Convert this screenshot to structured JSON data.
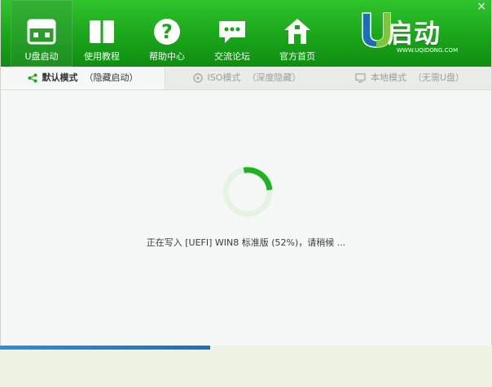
{
  "nav": {
    "items": [
      {
        "label": "U盘启动",
        "icon": "usb-drive-icon"
      },
      {
        "label": "使用教程",
        "icon": "book-icon"
      },
      {
        "label": "帮助中心",
        "icon": "help-question-icon"
      },
      {
        "label": "交流论坛",
        "icon": "chat-bubble-icon"
      },
      {
        "label": "官方首页",
        "icon": "home-icon"
      }
    ]
  },
  "logo": {
    "text": "启动",
    "url": "WWW.UQIDONG.COM"
  },
  "window": {
    "close_label": "×"
  },
  "tabs": [
    {
      "label": "默认模式",
      "sub": "（隐藏启动）",
      "icon": "share-node-icon"
    },
    {
      "label": "ISO模式",
      "sub": "（深度隐藏）",
      "icon": "disc-icon"
    },
    {
      "label": "本地模式",
      "sub": "（无需U盘）",
      "icon": "monitor-icon"
    }
  ],
  "progress": {
    "percent": 52
  },
  "status": {
    "text": "正在写入 [UEFI] WIN8 标准版 (52%)，请稍候 ..."
  },
  "colors": {
    "header": "#1aa51a",
    "accent": "#1fb321",
    "spinner_track": "#e4f3e4"
  }
}
